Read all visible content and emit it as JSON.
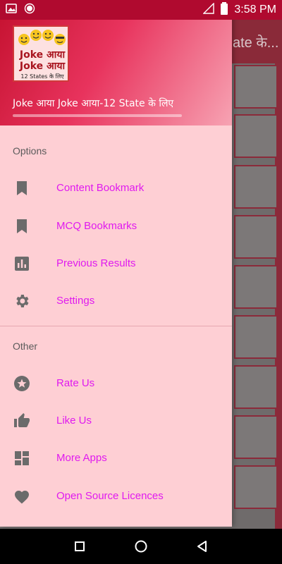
{
  "status_bar": {
    "time": "3:58 PM",
    "left_icons": [
      "image-icon",
      "record-icon"
    ],
    "right_icons": [
      "signal-icon",
      "battery-icon"
    ]
  },
  "background_app": {
    "toolbar_title_fragment": "ate के..."
  },
  "drawer": {
    "header": {
      "logo_line1": "Joke आया",
      "logo_line2": "Joke आया",
      "logo_line3": "12 States के लिए",
      "title": "Joke आया Joke आया-12 State के लिए"
    },
    "sections": [
      {
        "label": "Options",
        "items": [
          {
            "label": "Content Bookmark",
            "icon": "bookmark-icon"
          },
          {
            "label": "MCQ Bookmarks",
            "icon": "bookmark-icon"
          },
          {
            "label": "Previous Results",
            "icon": "bar-chart-icon"
          },
          {
            "label": "Settings",
            "icon": "gear-icon"
          }
        ]
      },
      {
        "label": "Other",
        "items": [
          {
            "label": "Rate Us",
            "icon": "star-icon"
          },
          {
            "label": "Like Us",
            "icon": "thumbs-up-icon"
          },
          {
            "label": "More Apps",
            "icon": "dashboard-icon"
          },
          {
            "label": "Open Source Licences",
            "icon": "heart-icon"
          }
        ]
      }
    ]
  },
  "nav_bar": {
    "buttons": [
      "recents-button",
      "home-button",
      "back-button"
    ]
  },
  "colors": {
    "accent_text": "#e01aef",
    "drawer_bg": "#fecfd4",
    "header_start": "#c4112f",
    "status_bar": "#b00a2f"
  }
}
